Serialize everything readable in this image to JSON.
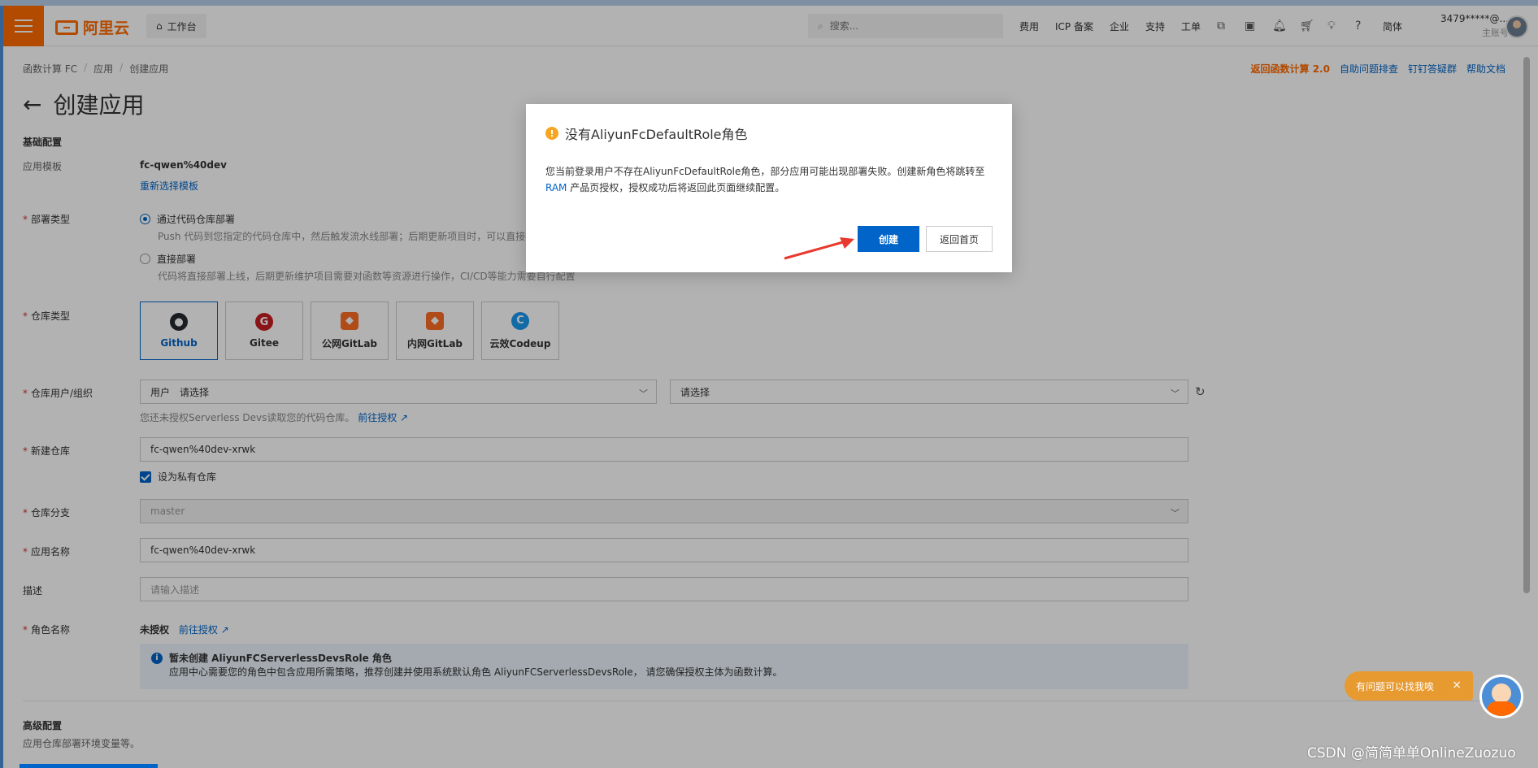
{
  "topbar": {
    "brand": "阿里云",
    "workbench": "工作台",
    "search_placeholder": "搜索...",
    "nav": [
      "费用",
      "ICP 备案",
      "企业",
      "支持",
      "工单"
    ],
    "lang": "简体",
    "account_name": "3479*****@...",
    "account_sub": "主账号"
  },
  "breadcrumb": [
    "函数计算 FC",
    "应用",
    "创建应用"
  ],
  "toplinks": {
    "back_v2": "返回函数计算 2.0",
    "self_check": "自助问题排查",
    "dingtalk": "钉钉答疑群",
    "docs": "帮助文档"
  },
  "page": {
    "title": "创建应用",
    "basic_section": "基础配置",
    "template_label": "应用模板",
    "template_value": "fc-qwen%40dev",
    "reselect": "重新选择模板",
    "deploy_type_label": "部署类型",
    "deploy_opt1": "通过代码仓库部署",
    "deploy_opt1_desc": "Push 代码到您指定的代码仓库中，然后触发流水线部署；后期更新项目时，可以直接推送代码至仓库进行自动部署",
    "deploy_opt2": "直接部署",
    "deploy_opt2_desc": "代码将直接部署上线，后期更新维护项目需要对函数等资源进行操作，CI/CD等能力需要自行配置",
    "repo_type_label": "仓库类型",
    "repo_types": [
      "Github",
      "Gitee",
      "公网GitLab",
      "内网GitLab",
      "云效Codeup"
    ],
    "repo_owner_label": "仓库用户/组织",
    "owner_prefix": "用户",
    "owner_placeholder": "请选择",
    "owner_placeholder2": "请选择",
    "auth_hint": "您还未授权Serverless Devs读取您的代码仓库。",
    "auth_link": "前往授权",
    "new_repo_label": "新建仓库",
    "new_repo_value": "fc-qwen%40dev-xrwk",
    "private_repo": "设为私有仓库",
    "branch_label": "仓库分支",
    "branch_value": "master",
    "app_name_label": "应用名称",
    "app_name_value": "fc-qwen%40dev-xrwk",
    "desc_label": "描述",
    "desc_placeholder": "请输入描述",
    "role_label": "角色名称",
    "role_status": "未授权",
    "role_auth_link": "前往授权",
    "notice_title": "暂未创建 AliyunFCServerlessDevsRole 角色",
    "notice_body": "应用中心需要您的角色中包含应用所需策略，推荐创建并使用系统默认角色 AliyunFCServerlessDevsRole， 请您确保授权主体为函数计算。",
    "advanced_section": "高级配置",
    "advanced_desc": "应用仓库部署环境变量等。"
  },
  "dialog": {
    "title": "没有AliyunFcDefaultRole角色",
    "body_prefix": "您当前登录用户不存在AliyunFcDefaultRole角色，部分应用可能出现部署失败。创建新角色将跳转至",
    "body_link": "RAM",
    "body_suffix": " 产品页授权，授权成功后将返回此页面继续配置。",
    "create_btn": "创建",
    "back_btn": "返回首页"
  },
  "help": {
    "bubble": "有问题可以找我唉"
  },
  "watermark": "CSDN @简简单单OnlineZuozuo",
  "colors": {
    "brand": "#ff6a00",
    "primary": "#0064c8",
    "warning": "#f5a623",
    "required": "#d93026"
  }
}
